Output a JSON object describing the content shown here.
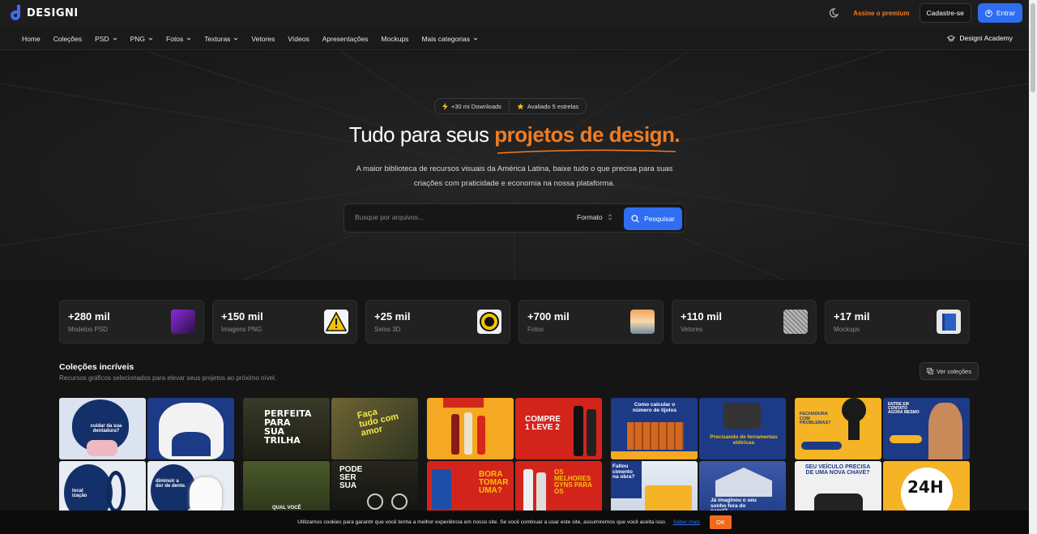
{
  "brand": {
    "name": "DESIGNI"
  },
  "topbar": {
    "premium": "Assine o premium",
    "signup": "Cadastre-se",
    "login": "Entrar"
  },
  "nav": {
    "items": [
      {
        "label": "Home"
      },
      {
        "label": "Coleções"
      },
      {
        "label": "PSD"
      },
      {
        "label": "PNG"
      },
      {
        "label": "Fotos"
      },
      {
        "label": "Texturas"
      },
      {
        "label": "Vetores"
      },
      {
        "label": "Vídeos"
      },
      {
        "label": "Apresentações"
      },
      {
        "label": "Mockups"
      },
      {
        "label": "Mais categorias"
      }
    ],
    "academy": "Designi Academy"
  },
  "hero": {
    "badge_downloads": "+30 mi Downloads",
    "badge_rating": "Avaliado 5 estrelas",
    "title_plain": "Tudo para seus ",
    "title_accent": "projetos de design.",
    "subtitle_1": "A maior biblioteca de recursos visuais da América Latina, baixe tudo o que precisa para suas",
    "subtitle_2": "criações com praticidade e economia na nossa plataforma.",
    "search_placeholder": "Busque por arquivos...",
    "format_label": "Formato",
    "search_button": "Pesquisar"
  },
  "stats": [
    {
      "value": "+280 mil",
      "label": "Modelos PSD"
    },
    {
      "value": "+150 mil",
      "label": "Imagens PNG"
    },
    {
      "value": "+25 mil",
      "label": "Selos 3D"
    },
    {
      "value": "+700 mil",
      "label": "Fotos"
    },
    {
      "value": "+110 mil",
      "label": "Vetores"
    },
    {
      "value": "+17 mil",
      "label": "Mockups"
    }
  ],
  "collections": {
    "title": "Coleções incríveis",
    "subtitle": "Recursos gráficos selecionados para elevar seus projetos ao próximo nível.",
    "view_all": "Ver coleções",
    "tiles": {
      "c1a": "cuidar da sua dentadura?",
      "c1c": "local ização",
      "c1d": "diminuir a dor de dente.",
      "c2a": "PERFEITA PARA SUA TRILHA",
      "c2b": "Faça tudo com amor",
      "c2c": "QUAL VOCÊ",
      "c2d": "PODE SER SUA",
      "c3b": "COMPRE 1 LEVE 2",
      "c3c": "BORA TOMAR UMA?",
      "c3d": "OS MELHORES GYNS PARA OS",
      "c4a": "Como calcular o número de tijolos",
      "c4b": "Precisando de ferramentas elétricas",
      "c4c": "Faltou cimento na obra?",
      "c4d": "Já imaginou o seu sonho fora do papel?",
      "c5a": "FECHADURA COM PROBLEMAS?",
      "c5b": "ENTRE EM CONTATO AGORA MESMO",
      "c5c": "SEU VEÍCULO PRECISA DE UMA NOVA CHAVE?",
      "c5d": "24H"
    }
  },
  "cookie": {
    "text": "Utilizamos cookies para garantir que você tenha a melhor experiência em nosso site. Se você continuar a usar este site, assumiremos que você aceita isso.",
    "link": "Saber mais",
    "ok": "OK"
  }
}
